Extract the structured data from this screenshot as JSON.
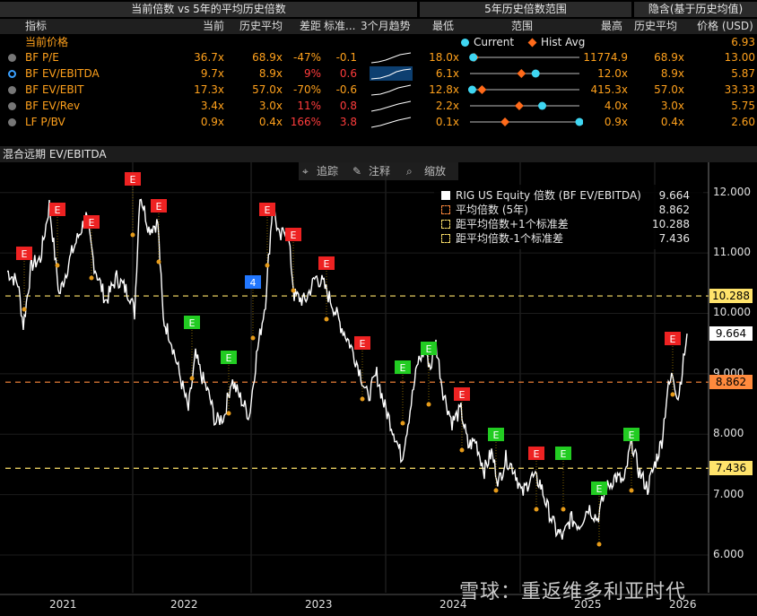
{
  "table": {
    "band_left": "当前倍数 vs 5年的平均历史倍数",
    "band_mid": "5年历史倍数范围",
    "band_right": "隐含(基于历史均值)",
    "headers": {
      "metric": "指标",
      "current": "当前",
      "hist_avg": "历史平均",
      "gap": "差距",
      "std": "标准...",
      "trend": "3个月趋势",
      "min": "最低",
      "range": "范围",
      "max": "最高",
      "hist_avg2": "历史平均",
      "price": "价格 (USD)"
    },
    "current_price_label": "当前价格",
    "current_price_value": "6.93",
    "legend_current": "Current",
    "legend_hist": "Hist Avg",
    "rows": [
      {
        "metric": "BF P/E",
        "current": "36.7x",
        "avg": "68.9x",
        "gap": "-47%",
        "gap_neg": true,
        "std": "-0.1",
        "min": "18.0x",
        "max": "11774.9",
        "avg2": "68.9x",
        "price": "13.00",
        "cur_pos": 0.03,
        "avg_pos": 0.04
      },
      {
        "metric": "BF EV/EBITDA",
        "current": "9.7x",
        "avg": "8.9x",
        "gap": "9%",
        "gap_neg": false,
        "std": "0.6",
        "min": "6.1x",
        "max": "12.0x",
        "avg2": "8.9x",
        "price": "5.87",
        "cur_pos": 0.6,
        "avg_pos": 0.47
      },
      {
        "metric": "BF EV/EBIT",
        "current": "17.3x",
        "avg": "57.0x",
        "gap": "-70%",
        "gap_neg": true,
        "std": "-0.6",
        "min": "12.8x",
        "max": "415.3x",
        "avg2": "57.0x",
        "price": "33.33",
        "cur_pos": 0.02,
        "avg_pos": 0.11
      },
      {
        "metric": "BF EV/Rev",
        "current": "3.4x",
        "avg": "3.0x",
        "gap": "11%",
        "gap_neg": false,
        "std": "0.8",
        "min": "2.2x",
        "max": "4.0x",
        "avg2": "3.0x",
        "price": "5.75",
        "cur_pos": 0.66,
        "avg_pos": 0.45
      },
      {
        "metric": "LF P/BV",
        "current": "0.9x",
        "avg": "0.4x",
        "gap": "166%",
        "gap_neg": false,
        "std": "3.8",
        "min": "0.1x",
        "max": "0.9x",
        "avg2": "0.4x",
        "price": "2.60",
        "cur_pos": 1.0,
        "avg_pos": 0.32
      }
    ]
  },
  "chart": {
    "title": "混合远期 EV/EBITDA",
    "toolbar": {
      "track": "追踪",
      "annotate": "注释",
      "zoom": "缩放"
    },
    "legend": [
      {
        "label": "RIG US Equity 倍数 (BF EV/EBITDA)",
        "value": "9.664",
        "color": "#ffffff",
        "style": "solid"
      },
      {
        "label": "平均倍数 (5年)",
        "value": "8.862",
        "color": "#ff8a3d",
        "style": "dash"
      },
      {
        "label": "距平均倍数+1个标准差",
        "value": "10.288",
        "color": "#ffe36b",
        "style": "dash"
      },
      {
        "label": "距平均倍数-1个标准差",
        "value": "7.436",
        "color": "#ffe36b",
        "style": "dash"
      }
    ],
    "tags": [
      {
        "value": "10.288",
        "bg": "#ffe36b",
        "fg": "#000"
      },
      {
        "value": "9.664",
        "bg": "#ffffff",
        "fg": "#000"
      },
      {
        "value": "8.862",
        "bg": "#ff8a3d",
        "fg": "#000"
      },
      {
        "value": "7.436",
        "bg": "#ffe36b",
        "fg": "#000"
      }
    ],
    "y_ticks": [
      "12.000",
      "11.000",
      "10.000",
      "9.000",
      "8.000",
      "7.000",
      "6.000"
    ],
    "x_ticks": [
      "2021",
      "2022",
      "2023",
      "2024",
      "2025",
      "2026"
    ],
    "watermark": "雪球：重返维多利亚时代"
  },
  "chart_data": {
    "type": "line",
    "title": "混合远期 EV/EBITDA",
    "ylim": [
      5.6,
      12.5
    ],
    "series": [
      {
        "name": "RIG US Equity 倍数 (BF EV/EBITDA)",
        "x": [
          "2020-10",
          "2021-01",
          "2021-03",
          "2021-06",
          "2021-09",
          "2021-12",
          "2022-02",
          "2022-04",
          "2022-06",
          "2022-08",
          "2022-10",
          "2022-12",
          "2023-02",
          "2023-04",
          "2023-06",
          "2023-08",
          "2023-10",
          "2023-12",
          "2024-02",
          "2024-04",
          "2024-06",
          "2024-08",
          "2024-10",
          "2024-12",
          "2025-02",
          "2025-04",
          "2025-06",
          "2025-08",
          "2025-10",
          "2025-12",
          "2026-01"
        ],
        "values": [
          10.7,
          10.4,
          11.8,
          10.4,
          11.2,
          10.2,
          12.0,
          9.9,
          9.2,
          8.3,
          9.0,
          8.4,
          10.0,
          11.8,
          10.1,
          10.6,
          9.7,
          9.1,
          8.3,
          9.1,
          9.2,
          8.2,
          7.5,
          7.4,
          7.0,
          7.0,
          6.3,
          6.8,
          7.3,
          7.7,
          9.66
        ]
      },
      {
        "name": "平均倍数 (5年)",
        "values": [
          8.862
        ]
      },
      {
        "name": "距平均倍数+1个标准差",
        "values": [
          10.288
        ]
      },
      {
        "name": "距平均倍数-1个标准差",
        "values": [
          7.436
        ]
      }
    ]
  }
}
